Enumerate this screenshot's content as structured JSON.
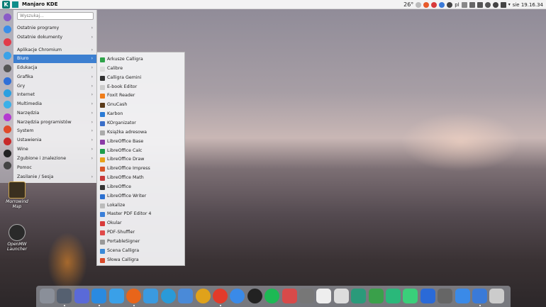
{
  "topbar": {
    "title": "Manjaro KDE",
    "temperature": "26°",
    "language": "pl",
    "datetime": "sie 19.16.34"
  },
  "menu": {
    "search_placeholder": "Wyszukaj...",
    "items": [
      {
        "label": "Ostatnie programy",
        "arrow": "›"
      },
      {
        "label": "Ostatnie dokumenty",
        "arrow": "›"
      },
      {
        "label": "Aplikacje Chromium",
        "arrow": "›"
      },
      {
        "label": "Biuro",
        "arrow": "›"
      },
      {
        "label": "Edukacja",
        "arrow": "›"
      },
      {
        "label": "Grafika",
        "arrow": "›"
      },
      {
        "label": "Gry",
        "arrow": "›"
      },
      {
        "label": "Internet",
        "arrow": "›"
      },
      {
        "label": "Multimedia",
        "arrow": "›"
      },
      {
        "label": "Narzędzia",
        "arrow": "›"
      },
      {
        "label": "Narzędzia programistów",
        "arrow": "›"
      },
      {
        "label": "System",
        "arrow": "›"
      },
      {
        "label": "Ustawienia",
        "arrow": "›"
      },
      {
        "label": "Wine",
        "arrow": "›"
      },
      {
        "label": "Zgubione i znalezione",
        "arrow": "›"
      },
      {
        "label": "Pomoc",
        "arrow": ""
      },
      {
        "label": "Zasilanie / Sesja",
        "arrow": "›"
      }
    ]
  },
  "submenu": {
    "items": [
      {
        "label": "Arkusze Calligra",
        "color": "#2fa34a"
      },
      {
        "label": "Calibre",
        "color": "#dddddd"
      },
      {
        "label": "Calligra Gemini",
        "color": "#333333"
      },
      {
        "label": "E-book Editor",
        "color": "#cccccc"
      },
      {
        "label": "Foxit Reader",
        "color": "#f07d1a"
      },
      {
        "label": "GnuCash",
        "color": "#5a3a1a"
      },
      {
        "label": "Karbon",
        "color": "#2a7bd5"
      },
      {
        "label": "KOrganizator",
        "color": "#3a6ec8"
      },
      {
        "label": "Książka adresowa",
        "color": "#aaaaaa"
      },
      {
        "label": "LibreOffice Base",
        "color": "#8b3aa6"
      },
      {
        "label": "LibreOffice Calc",
        "color": "#1e9e4a"
      },
      {
        "label": "LibreOffice Draw",
        "color": "#e8a21a"
      },
      {
        "label": "LibreOffice Impress",
        "color": "#d8552a"
      },
      {
        "label": "LibreOffice Math",
        "color": "#c83a3a"
      },
      {
        "label": "LibreOffice",
        "color": "#333333"
      },
      {
        "label": "LibreOffice Writer",
        "color": "#2a6fd0"
      },
      {
        "label": "Lokalize",
        "color": "#bbbbbb"
      },
      {
        "label": "Master PDF Editor 4",
        "color": "#3a7fd8"
      },
      {
        "label": "Okular",
        "color": "#d83a3a"
      },
      {
        "label": "PDF-Shuffler",
        "color": "#e04a4a"
      },
      {
        "label": "PortableSigner",
        "color": "#999999"
      },
      {
        "label": "Scena Calligra",
        "color": "#3a8ad8"
      },
      {
        "label": "Słowa Calligra",
        "color": "#d84a2a"
      }
    ]
  },
  "desktop": {
    "icons": [
      {
        "label_line1": "Morrowind",
        "label_line2": "Map"
      },
      {
        "label_line1": "OpenMW",
        "label_line2": "Launcher"
      }
    ]
  },
  "rail_colors": [
    "#8a5bc7",
    "#3a8ee8",
    "#e23b4a",
    "#3aa2e8",
    "#555555",
    "#2f6fd8",
    "#2a9fe0",
    "#3ab0e8",
    "#b43ad0",
    "#e04a2a",
    "#c82a2a",
    "#222222",
    "#444444"
  ],
  "dock_colors": [
    "#8a8f99",
    "#556070",
    "#5a6ad8",
    "#2a8ae0",
    "#3aa0e8",
    "#e8651a",
    "#3a9ae0",
    "#2a9ad8",
    "#4a8ad8",
    "#e0a21a",
    "#e23b2a",
    "#3a8ae8",
    "#222222",
    "#1db954",
    "#d84a4a",
    "#777777",
    "#eeeeee",
    "#dddddd",
    "#2a9a7a",
    "#3aa04a",
    "#2ab87a",
    "#3acf7a",
    "#2a6ad8",
    "#666666",
    "#3a8ae8",
    "#3a7ad8",
    "#cccccc"
  ]
}
